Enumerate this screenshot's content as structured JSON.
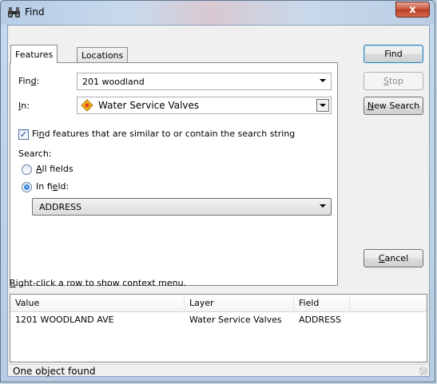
{
  "window": {
    "title": "Find",
    "close_label": "x"
  },
  "tabs": [
    {
      "label": "Features",
      "active": true
    },
    {
      "label": "Locations",
      "active": false
    }
  ],
  "find": {
    "label_pre": "Fin",
    "label_u": "d",
    "label_post": ":",
    "value": "201 woodland"
  },
  "in": {
    "label_u": "I",
    "label_post": "n:",
    "value": "Water Service Valves"
  },
  "similar": {
    "checked": true,
    "label_pre": "Fi",
    "label_u": "n",
    "label_post": "d features that are similar to or contain the search string"
  },
  "search": {
    "label": "Search:",
    "all_fields": {
      "label_u": "A",
      "label_post": "ll fields",
      "selected": false
    },
    "in_field": {
      "label_pre": "In fi",
      "label_u": "e",
      "label_post": "ld:",
      "selected": true
    },
    "field_value": "ADDRESS"
  },
  "buttons": {
    "find": "Find",
    "stop_u": "S",
    "stop_post": "top",
    "new_search_u": "N",
    "new_search_post": "ew Search",
    "cancel_u": "C",
    "cancel_post": "ancel"
  },
  "context_hint": {
    "label_u": "R",
    "label_post": "ight-click a row to show context menu."
  },
  "results": {
    "columns": [
      "Value",
      "Layer",
      "Field"
    ],
    "rows": [
      [
        "1201 WOODLAND AVE",
        "Water Service Valves",
        "ADDRESS"
      ]
    ]
  },
  "status": "One object found"
}
